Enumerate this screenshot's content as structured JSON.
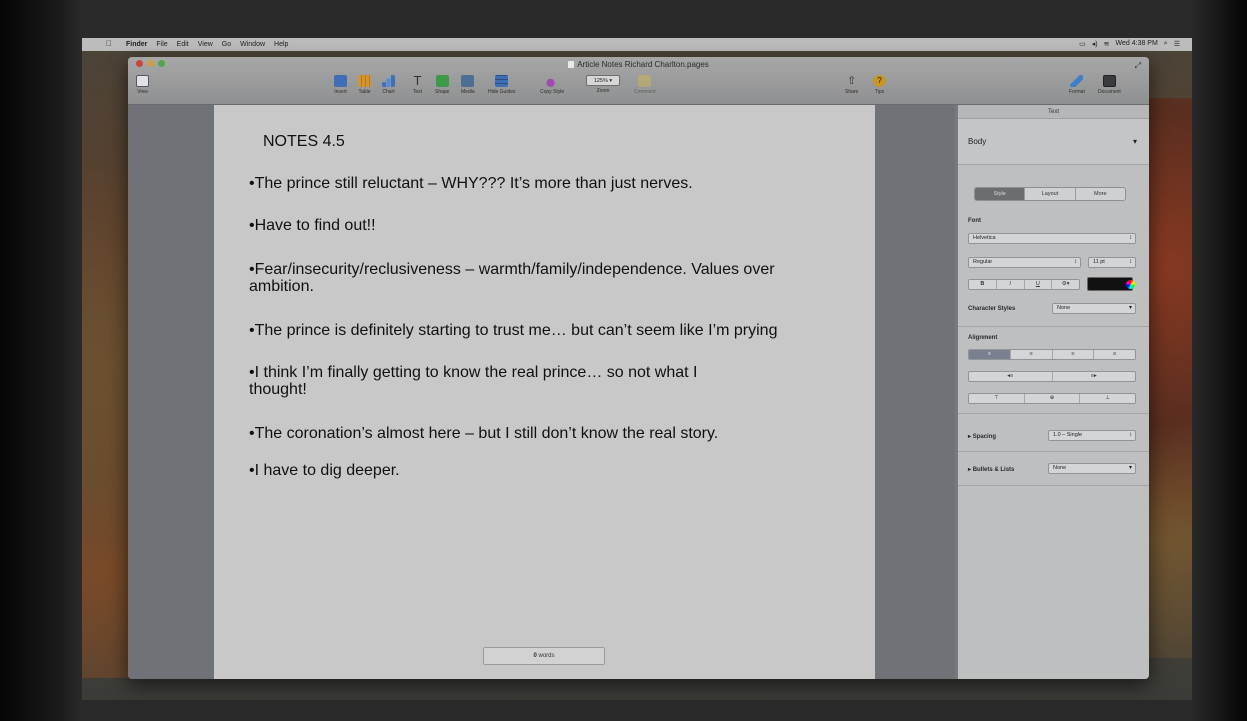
{
  "menubar": {
    "apple": "",
    "items": [
      "Finder",
      "File",
      "Edit",
      "View",
      "Go",
      "Window",
      "Help"
    ],
    "clock": "Wed 4:38 PM"
  },
  "window": {
    "title": "Article Notes Richard Charlton.pages"
  },
  "toolbar": {
    "view_label": "View",
    "insert_label": "Insert",
    "table_label": "Table",
    "chart_label": "Chart",
    "text_label": "Text",
    "shape_label": "Shape",
    "media_label": "Media",
    "hide_guides_label": "Hide Guides",
    "copy_style_label": "Copy Style",
    "zoom_value": "125%",
    "zoom_label": "Zoom",
    "comment_label": "Comment",
    "share_label": "Share",
    "tips_label": "Tips",
    "format_label": "Format",
    "document_label": "Document"
  },
  "document": {
    "title": "NOTES 4.5",
    "lines": [
      "•The prince still reluctant – WHY??? It’s more than just nerves.",
      "•Have to find out!!",
      "•Fear/insecurity/reclusiveness – warmth/family/independence. Values over",
      "ambition.",
      "•The prince is definitely starting to trust me… but can’t seem like I’m prying",
      "•I think I’m finally getting to know the real prince… so not what I",
      "thought!",
      "•The coronation’s almost here – but I still don’t know the real story.",
      "•I have to dig deeper."
    ],
    "word_count_num": "0",
    "word_count_label": "words"
  },
  "inspector": {
    "header": "Text",
    "paragraph_style": "Body",
    "tabs": [
      "Style",
      "Layout",
      "More"
    ],
    "font_label": "Font",
    "font_family": "Helvetica",
    "font_weight": "Regular",
    "font_size": "11 pt",
    "format_buttons": [
      "B",
      "I",
      "U",
      "⚙▾"
    ],
    "char_styles_label": "Character Styles",
    "char_styles_value": "None",
    "alignment_label": "Alignment",
    "align_buttons": [
      "≡",
      "≡",
      "≡",
      "≡"
    ],
    "indent_buttons": [
      "◂≡",
      "≡▸"
    ],
    "valign_buttons": [
      "⊤",
      "⊕",
      "⊥"
    ],
    "spacing_label": "Spacing",
    "spacing_value": "1.0 – Single",
    "bullets_label": "Bullets & Lists",
    "bullets_value": "None"
  },
  "colors": {
    "page": "#c8c8c9",
    "inspector": "#bebfc1",
    "toolbar": "#9c9d9e"
  }
}
